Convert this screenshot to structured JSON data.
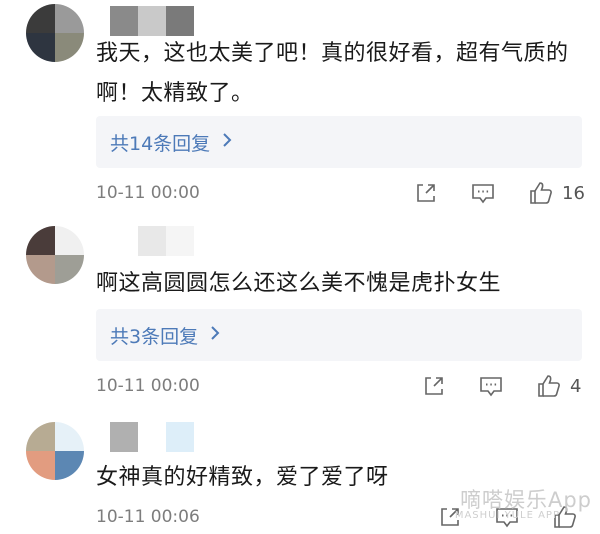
{
  "comments": [
    {
      "text": "我天，这也太美了吧！真的很好看，超有气质的啊！太精致了。",
      "reply_label": "共14条回复",
      "time": "10-11 00:00",
      "likes": "16",
      "avatar_colors": [
        "#3b3b3b",
        "#9a9a9a",
        "#2e3540",
        "#8a8a7a"
      ],
      "name_colors": [
        "#8a8a8a",
        "#c9c9c9",
        "#7a7a7a"
      ]
    },
    {
      "text": "啊这高圆圆怎么还这么美不愧是虎扑女生",
      "reply_label": "共3条回复",
      "time": "10-11 00:00",
      "likes": "4",
      "avatar_colors": [
        "#4a3c3a",
        "#f0f0f0",
        "#b39a8c",
        "#9e9e96"
      ],
      "name_colors": [
        "#ffffff",
        "#e8e8e8",
        "#f5f5f5"
      ]
    },
    {
      "text": "女神真的好精致，爱了爱了呀",
      "time": "10-11 00:06",
      "likes": "",
      "avatar_colors": [
        "#b7ab93",
        "#e6f1f8",
        "#e29c80",
        "#5c87b3"
      ],
      "name_colors": [
        "#b0b0b0",
        "#ffffff",
        "#ddeef9"
      ]
    }
  ],
  "watermark": "嘀嗒娱乐App",
  "watermark_sub": "MASHUI YULE APP",
  "icons": {
    "share": "share-icon",
    "comment": "comment-icon",
    "like": "thumbs-up-icon",
    "chevron": "chevron-right-icon"
  },
  "colors": {
    "link": "#4d7ab8",
    "reply_bg": "#f4f5f8",
    "meta": "#7d7d7d"
  }
}
